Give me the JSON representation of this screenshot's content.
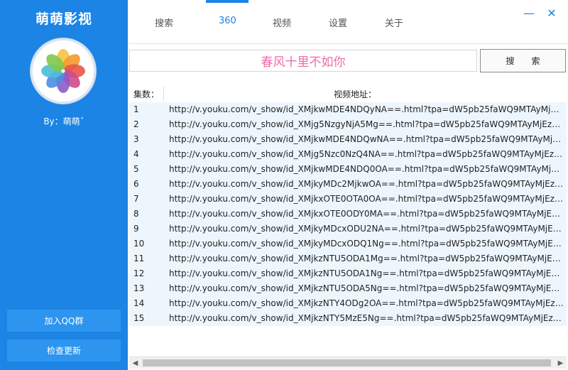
{
  "app": {
    "title": "萌萌影视",
    "byline": "By：萌萌ˇ"
  },
  "sidebar": {
    "qq_button": "加入QQ群",
    "update_button": "检查更新"
  },
  "tabs": [
    {
      "label": "搜索"
    },
    {
      "label": "360"
    },
    {
      "label": "视频"
    },
    {
      "label": "设置"
    },
    {
      "label": "关于"
    }
  ],
  "active_tab": "360",
  "window": {
    "minimize": "—",
    "close": "✕"
  },
  "search": {
    "value": "春风十里不如你",
    "button": "搜索"
  },
  "table": {
    "col_episode": "集数：",
    "col_url": "视频地址：",
    "rows": [
      {
        "idx": "1",
        "url": "http://v.youku.com/v_show/id_XMjkwMDE4NDQyNA==.html?tpa=dW5pb25faWQ9MTAyMjEz..."
      },
      {
        "idx": "2",
        "url": "http://v.youku.com/v_show/id_XMjg5NzgyNjA5Mg==.html?tpa=dW5pb25faWQ9MTAyMjEzX..."
      },
      {
        "idx": "3",
        "url": "http://v.youku.com/v_show/id_XMjkwMDE4NDQwNA==.html?tpa=dW5pb25faWQ9MTAyMjEz..."
      },
      {
        "idx": "4",
        "url": "http://v.youku.com/v_show/id_XMjg5Nzc0NzQ4NA==.html?tpa=dW5pb25faWQ9MTAyMjEzX..."
      },
      {
        "idx": "5",
        "url": "http://v.youku.com/v_show/id_XMjkwMDE4NDQ0OA==.html?tpa=dW5pb25faWQ9MTAyMjEz..."
      },
      {
        "idx": "6",
        "url": "http://v.youku.com/v_show/id_XMjkyMDc2MjkwOA==.html?tpa=dW5pb25faWQ9MTAyMjEzX..."
      },
      {
        "idx": "7",
        "url": "http://v.youku.com/v_show/id_XMjkxOTE0OTA0OA==.html?tpa=dW5pb25faWQ9MTAyMjEzX..."
      },
      {
        "idx": "8",
        "url": "http://v.youku.com/v_show/id_XMjkxOTE0ODY0MA==.html?tpa=dW5pb25faWQ9MTAyMjEzX..."
      },
      {
        "idx": "9",
        "url": "http://v.youku.com/v_show/id_XMjkyMDcxODU2NA==.html?tpa=dW5pb25faWQ9MTAyMjEzX..."
      },
      {
        "idx": "10",
        "url": "http://v.youku.com/v_show/id_XMjkyMDcxODQ1Ng==.html?tpa=dW5pb25faWQ9MTAyMjEzX..."
      },
      {
        "idx": "11",
        "url": "http://v.youku.com/v_show/id_XMjkzNTU5ODA1Mg==.html?tpa=dW5pb25faWQ9MTAyMjEzX..."
      },
      {
        "idx": "12",
        "url": "http://v.youku.com/v_show/id_XMjkzNTU5ODA1Ng==.html?tpa=dW5pb25faWQ9MTAyMjEzX..."
      },
      {
        "idx": "13",
        "url": "http://v.youku.com/v_show/id_XMjkzNTU5ODA5Ng==.html?tpa=dW5pb25faWQ9MTAyMjEzX..."
      },
      {
        "idx": "14",
        "url": "http://v.youku.com/v_show/id_XMjkzNTY4ODg2OA==.html?tpa=dW5pb25faWQ9MTAyMjEzX..."
      },
      {
        "idx": "15",
        "url": "http://v.youku.com/v_show/id_XMjkzNTY5MzE5Ng==.html?tpa=dW5pb25faWQ9MTAyMjEzX..."
      }
    ]
  },
  "colors": {
    "sidebar": "#1b84e4",
    "accent": "#1b84e4",
    "search_text": "#f06ba8",
    "row_bg": "#eef6fd"
  },
  "icons": {
    "avatar": "photos-flower-icon",
    "minimize": "minimize-icon",
    "close": "close-icon",
    "scroll_left": "arrow-left-icon",
    "scroll_right": "arrow-right-icon"
  }
}
